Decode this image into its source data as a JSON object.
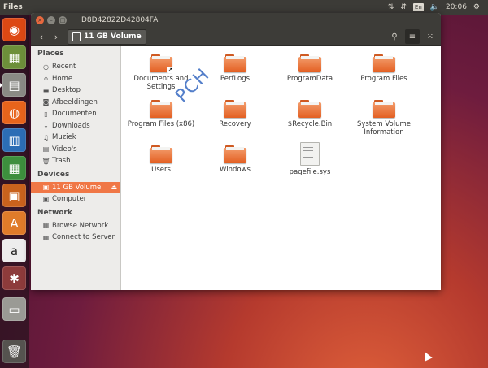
{
  "panel": {
    "app_name": "Files",
    "keyboard": "En",
    "time": "20:06"
  },
  "window": {
    "title": "D8D42822D42804FA",
    "location": "11 GB Volume"
  },
  "sidebar": {
    "places_header": "Places",
    "places": [
      {
        "label": "Recent",
        "icon": "clock-icon"
      },
      {
        "label": "Home",
        "icon": "home-icon"
      },
      {
        "label": "Desktop",
        "icon": "desktop-icon"
      },
      {
        "label": "Afbeeldingen",
        "icon": "camera-icon"
      },
      {
        "label": "Documenten",
        "icon": "document-icon"
      },
      {
        "label": "Downloads",
        "icon": "download-icon"
      },
      {
        "label": "Muziek",
        "icon": "music-icon"
      },
      {
        "label": "Video's",
        "icon": "film-icon"
      },
      {
        "label": "Trash",
        "icon": "trash-icon"
      }
    ],
    "devices_header": "Devices",
    "devices": [
      {
        "label": "11 GB Volume",
        "icon": "drive-icon",
        "selected": true
      },
      {
        "label": "Computer",
        "icon": "computer-icon"
      }
    ],
    "network_header": "Network",
    "network": [
      {
        "label": "Browse Network",
        "icon": "network-icon"
      },
      {
        "label": "Connect to Server",
        "icon": "server-icon"
      }
    ]
  },
  "files": [
    {
      "name": "Documents and Settings",
      "type": "folder-link"
    },
    {
      "name": "PerfLogs",
      "type": "folder"
    },
    {
      "name": "ProgramData",
      "type": "folder"
    },
    {
      "name": "Program Files",
      "type": "folder"
    },
    {
      "name": "Program Files (x86)",
      "type": "folder"
    },
    {
      "name": "Recovery",
      "type": "folder"
    },
    {
      "name": "$Recycle.Bin",
      "type": "folder"
    },
    {
      "name": "System Volume Information",
      "type": "folder"
    },
    {
      "name": "Users",
      "type": "folder"
    },
    {
      "name": "Windows",
      "type": "folder"
    },
    {
      "name": "pagefile.sys",
      "type": "file"
    }
  ],
  "watermark": "PCH",
  "colors": {
    "accent": "#f07746",
    "panel": "#3c3b37",
    "folder": "#e35f22"
  }
}
